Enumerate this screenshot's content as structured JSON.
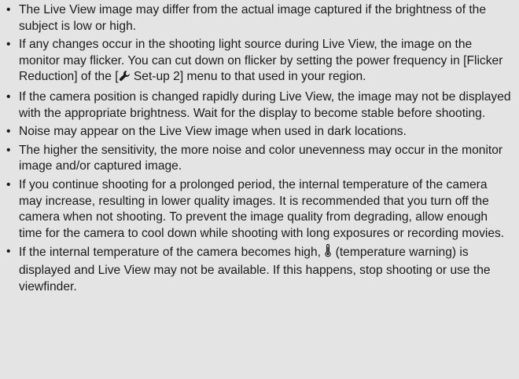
{
  "notes": {
    "bullet_glyph": "•",
    "items": [
      {
        "text": "The Live View image may differ from the actual image captured if the brightness of the subject is low or high."
      },
      {
        "text_before_icon": "If any changes occur in the shooting light source during Live View, the image on the monitor may flicker. You can cut down on flicker by setting the power frequency in [Flicker Reduction] of the [",
        "icon": "wrench-icon",
        "text_after_icon": " Set-up 2] menu to that used in your region."
      },
      {
        "text": "If the camera position is changed rapidly during Live View, the image may not be displayed with the appropriate brightness. Wait for the display to become stable before shooting."
      },
      {
        "text": "Noise may appear on the Live View image when used in dark locations."
      },
      {
        "text": "The higher the sensitivity, the more noise and color unevenness may occur in the monitor image and/or captured image."
      },
      {
        "text": "If you continue shooting for a prolonged period, the internal temperature of the camera may increase, resulting in lower quality images. It is recommended that you turn off the camera when not shooting. To prevent the image quality from degrading, allow enough time for the camera to cool down while shooting with long exposures or recording movies."
      },
      {
        "text_before_icon": "If the internal temperature of the camera becomes high, ",
        "icon": "thermometer-icon",
        "text_after_icon": " (temperature warning) is displayed and Live View may not be available. If this happens, stop shooting or use the viewfinder."
      }
    ]
  }
}
